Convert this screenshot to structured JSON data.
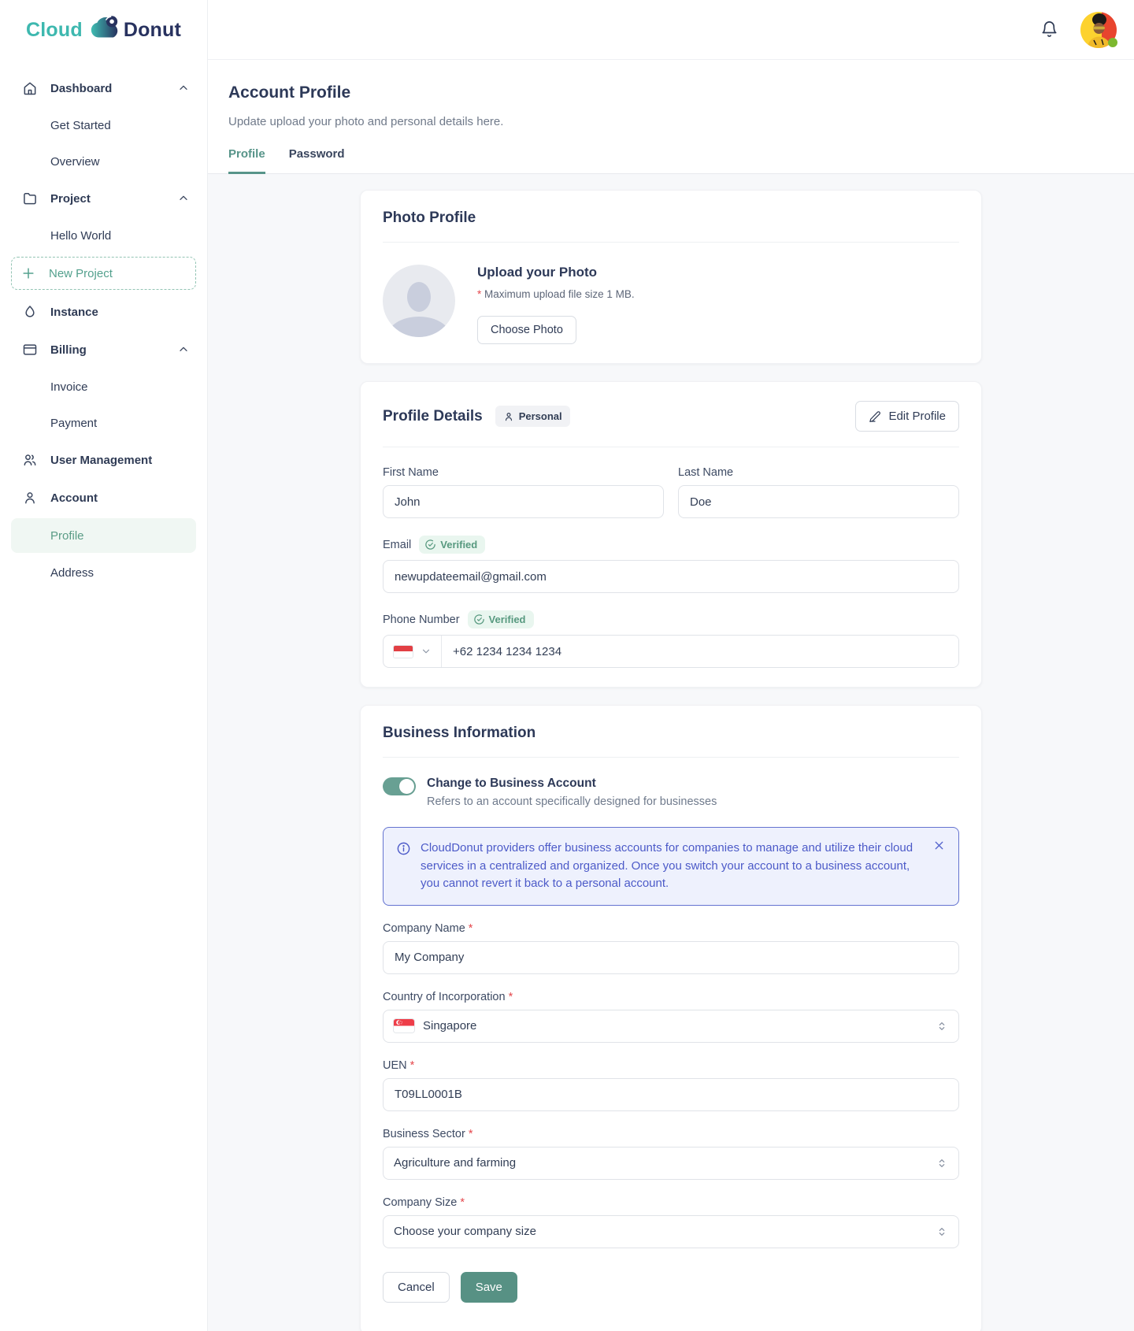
{
  "colors": {
    "accent_teal": "#579489",
    "logo_teal": "#3eb8af",
    "logo_navy": "#28325f",
    "sidebar_active_bg": "#f0f7f3",
    "save_button_bg": "#579184",
    "verified_text": "#57997f",
    "verified_bg": "#e9f6ef",
    "alert_text": "#4c5ac8",
    "alert_bg": "#eef1fd",
    "alert_border": "#6473d0",
    "required_mark_color": "#e5484d",
    "status_dot": "#7cb82f"
  },
  "brand": {
    "part1": "Cloud",
    "part2": "Donut"
  },
  "sidebar": {
    "items": [
      {
        "label": "Dashboard"
      },
      {
        "label": "Get Started"
      },
      {
        "label": "Overview"
      },
      {
        "label": "Project"
      },
      {
        "label": "Hello World"
      },
      {
        "label": "New Project"
      },
      {
        "label": "Instance"
      },
      {
        "label": "Billing"
      },
      {
        "label": "Invoice"
      },
      {
        "label": "Payment"
      },
      {
        "label": "User Management"
      },
      {
        "label": "Account"
      },
      {
        "label": "Profile"
      },
      {
        "label": "Address"
      }
    ]
  },
  "page": {
    "title": "Account Profile",
    "subtitle": "Update upload your photo and personal details here.",
    "tabs": [
      {
        "label": "Profile"
      },
      {
        "label": "Password"
      }
    ]
  },
  "photo_card": {
    "title": "Photo Profile",
    "upload_title": "Upload your Photo",
    "required_mark": "*",
    "upload_note": "Maximum upload file size 1 MB.",
    "choose_button": "Choose Photo"
  },
  "profile_card": {
    "title": "Profile Details",
    "badge": "Personal",
    "edit_button": "Edit Profile",
    "first_name": {
      "label": "First Name",
      "value": "John"
    },
    "last_name": {
      "label": "Last Name",
      "value": "Doe"
    },
    "email": {
      "label": "Email",
      "badge": "Verified",
      "value": "newupdateemail@gmail.com"
    },
    "phone": {
      "label": "Phone Number",
      "badge": "Verified",
      "value": "+62 1234 1234 1234"
    }
  },
  "business_card": {
    "title": "Business Information",
    "toggle_label": "Change to Business Account",
    "toggle_desc": "Refers to an account specifically designed for businesses",
    "alert_text": "CloudDonut providers offer business accounts for companies to manage and utilize their cloud services in a centralized and organized. Once you switch your account to a business account, you cannot revert it back to a personal account.",
    "required_mark": "*",
    "company_name": {
      "label": "Company Name",
      "value": "My Company"
    },
    "country": {
      "label": "Country of Incorporation",
      "value": "Singapore"
    },
    "uen": {
      "label": "UEN",
      "value": "T09LL0001B"
    },
    "sector": {
      "label": "Business Sector",
      "value": "Agriculture and farming"
    },
    "size": {
      "label": "Company Size",
      "placeholder": "Choose your company size"
    },
    "cancel_button": "Cancel",
    "save_button": "Save"
  }
}
